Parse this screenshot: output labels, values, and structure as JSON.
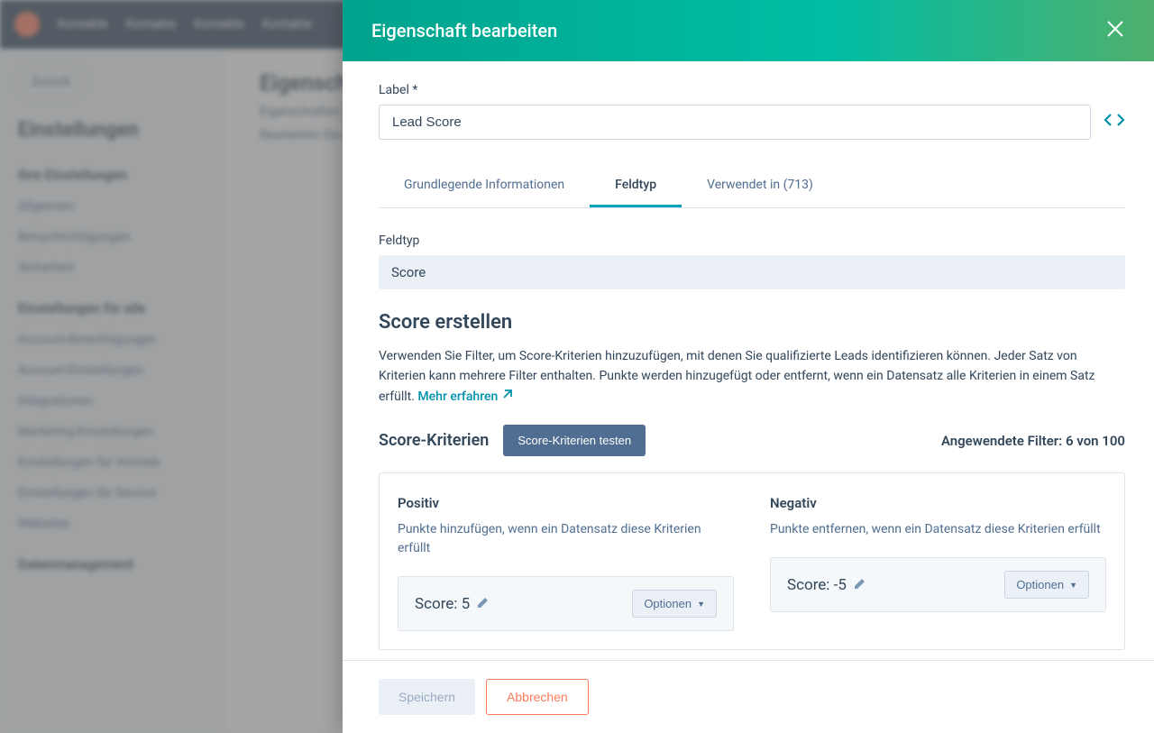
{
  "bg": {
    "nav": [
      "Kontakte",
      "Kontakte",
      "Kontakte",
      "Kontakte"
    ],
    "back": "Zurück",
    "settings_title": "Einstellungen",
    "section1": "Ihre Einstellungen",
    "items1": [
      "Allgemein",
      "Benachrichtigungen",
      "Sicherheit"
    ],
    "section2": "Einstellungen für alle",
    "items2": [
      "Account-Berechtigungen",
      "Account-Einstellungen",
      "Integrationen",
      "Marketing-Einstellungen",
      "Einstellungen für Vertrieb",
      "Einstellungen für Service",
      "Websites"
    ],
    "section3": "Datenmanagement",
    "main_title": "Eigenschaften",
    "main_desc1": "Eigenschaften werden zum Speichern von Informationen verwendet.",
    "main_desc2": "Bearbeiten Sie Eigenschaften."
  },
  "panel": {
    "title": "Eigenschaft bearbeiten",
    "label_field": "Label *",
    "label_value": "Lead Score",
    "tabs": {
      "basic": "Grundlegende Informationen",
      "fieldtype": "Feldtyp",
      "usedin": "Verwendet in (713)"
    },
    "fieldtype_label": "Feldtyp",
    "fieldtype_value": "Score",
    "score_heading": "Score erstellen",
    "score_desc": "Verwenden Sie Filter, um Score-Kriterien hinzuzufügen, mit denen Sie qualifizierte Leads identifizieren können. Jeder Satz von Kriterien kann mehrere Filter enthalten. Punkte werden hinzugefügt oder entfernt, wenn ein Datensatz alle Kriterien in einem Satz erfüllt. ",
    "learn_more": "Mehr erfahren",
    "criteria_heading": "Score-Kriterien",
    "test_button": "Score-Kriterien testen",
    "filter_count": "Angewendete Filter: 6 von 100",
    "positive": {
      "title": "Positiv",
      "desc": "Punkte hinzufügen, wenn ein Datensatz diese Kriterien erfüllt",
      "score_label": "Score: 5",
      "options": "Optionen"
    },
    "negative": {
      "title": "Negativ",
      "desc": "Punkte entfernen, wenn ein Datensatz diese Kriterien erfüllt",
      "score_label": "Score: -5",
      "options": "Optionen"
    },
    "save": "Speichern",
    "cancel": "Abbrechen"
  }
}
